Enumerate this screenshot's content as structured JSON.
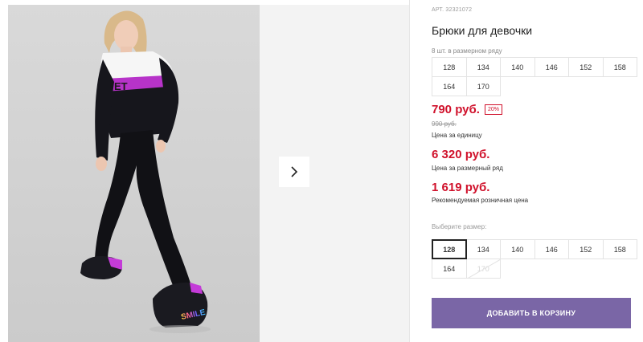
{
  "product": {
    "sku": "АРТ. 32321072",
    "title": "Брюки для девочки",
    "sizes_count_label": "8 шт. в размерном ряду",
    "info_sizes": [
      "128",
      "134",
      "140",
      "146",
      "152",
      "158",
      "164",
      "170"
    ],
    "price": "790 руб.",
    "discount": "20%",
    "old_price": "990 руб.",
    "unit_price_caption": "Цена за единицу",
    "row_price": "6 320 руб.",
    "row_price_caption": "Цена за размерный ряд",
    "retail_price": "1 619 руб.",
    "retail_price_caption": "Рекомендуемая розничная цена",
    "choose_size_label": "Выберите размер:",
    "select_sizes": [
      {
        "label": "128",
        "state": "selected"
      },
      {
        "label": "134",
        "state": "available"
      },
      {
        "label": "140",
        "state": "available"
      },
      {
        "label": "146",
        "state": "available"
      },
      {
        "label": "152",
        "state": "available"
      },
      {
        "label": "158",
        "state": "available"
      },
      {
        "label": "164",
        "state": "available"
      },
      {
        "label": "170",
        "state": "disabled"
      }
    ],
    "add_to_cart_label": "ДОБАВИТЬ В КОРЗИНУ"
  },
  "gallery": {
    "next_icon": "chevron-right-icon",
    "shirt_print": "ET",
    "shoe_print": "SMILE"
  },
  "colors": {
    "price_red": "#d0112b",
    "button_purple": "#7a66a6",
    "accent_magenta": "#c43bd8"
  }
}
